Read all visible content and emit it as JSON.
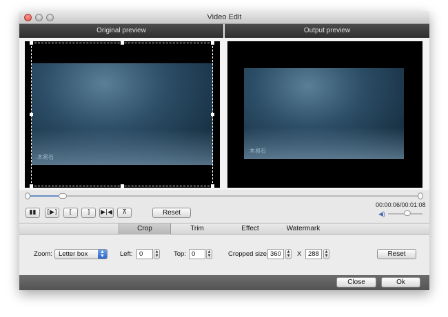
{
  "window": {
    "title": "Video Edit"
  },
  "preview": {
    "original_label": "Original preview",
    "output_label": "Output preview",
    "watermark": "木易石"
  },
  "timeline": {
    "progress_fraction": 0.09
  },
  "controls": {
    "pause_icon": "pause-icon",
    "pause_glyph": "▮▮",
    "next_frame_glyph": "[▶]",
    "mark_in_glyph": "[",
    "mark_out_glyph": "]",
    "step_glyph": "▶|◀",
    "split_glyph": "⊼",
    "reset_label": "Reset"
  },
  "playback": {
    "time": "00:00:06/00:01:08",
    "volume_fraction": 0.55
  },
  "tabs": [
    {
      "label": "Crop",
      "active": true
    },
    {
      "label": "Trim",
      "active": false
    },
    {
      "label": "Effect",
      "active": false
    },
    {
      "label": "Watermark",
      "active": false
    }
  ],
  "crop": {
    "zoom_label": "Zoom:",
    "zoom_value": "Letter box",
    "left_label": "Left:",
    "left_value": "0",
    "top_label": "Top:",
    "top_value": "0",
    "cropped_size_label": "Cropped size:",
    "width_value": "360",
    "x_label": "X",
    "height_value": "288",
    "reset_label": "Reset"
  },
  "footer": {
    "close_label": "Close",
    "ok_label": "Ok"
  },
  "colors": {
    "accent": "#2a66c9",
    "footer": "#5c5c5c"
  }
}
